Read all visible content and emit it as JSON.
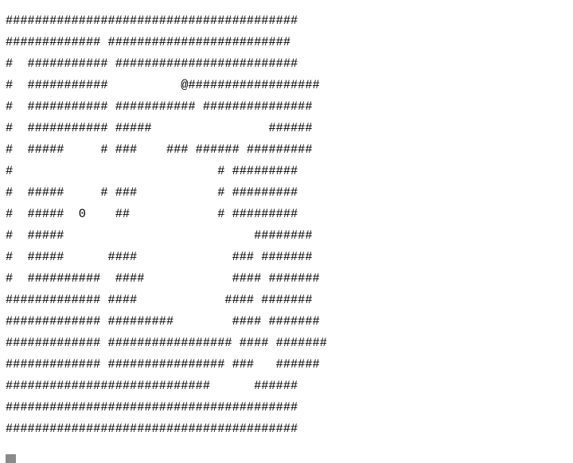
{
  "map": {
    "rows": [
      "########################################",
      "############# #########################",
      "#  ########### #########################",
      "#  ###########          @##################",
      "#  ########### ########### ###############",
      "#  ########### #####                ######",
      "#  #####     # ###    ### ###### #########",
      "#                            # #########",
      "#  #####     # ###           # #########",
      "#  #####  0    ##            # #########",
      "#  #####                          ########",
      "#  #####      ####             ### #######",
      "#  ##########  ####            #### #######",
      "############# ####            #### #######",
      "############# #########        #### #######",
      "############# ################# #### #######",
      "############# ################ ###   ######",
      "############################      ######",
      "########################################",
      "########################################"
    ]
  },
  "player_symbol": "@",
  "item_symbol": "0",
  "colors": {
    "background": "#ffffff",
    "text": "#000000",
    "cursor": "#8a8a8a"
  }
}
